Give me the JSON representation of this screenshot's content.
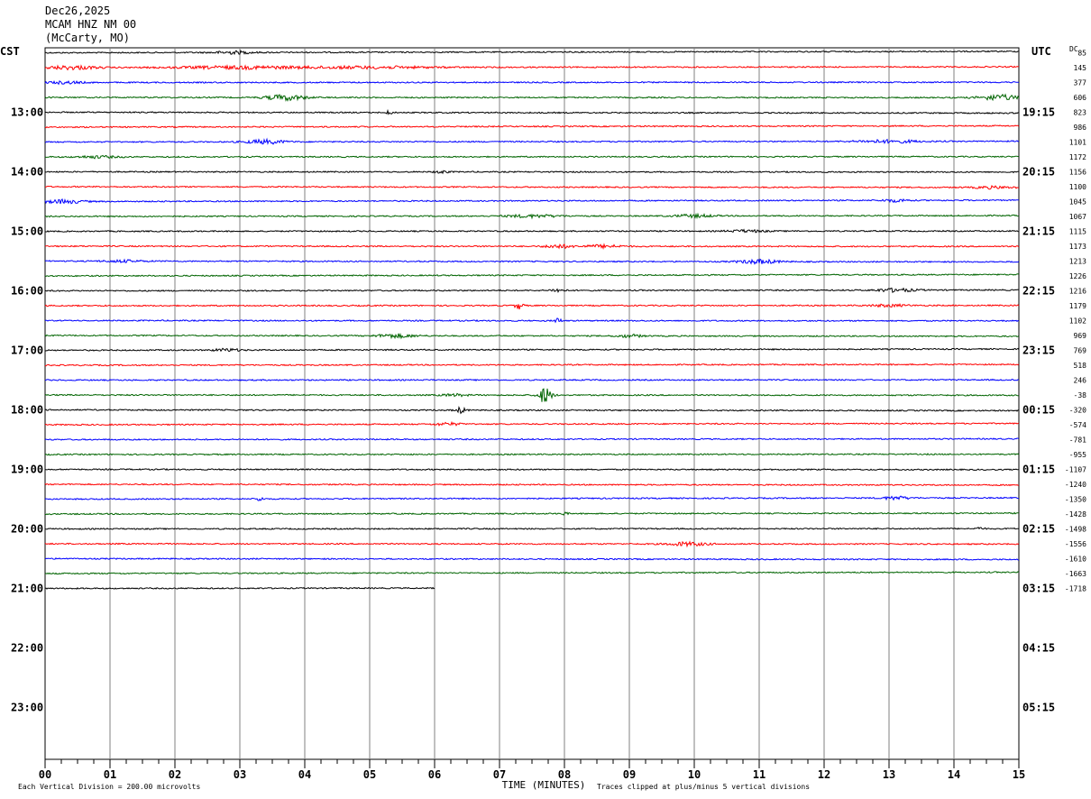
{
  "header": {
    "date": "Dec26,2025",
    "station": "MCAM HNZ NM 00",
    "location": "(McCarty, MO)"
  },
  "left_timezone": "CST",
  "right_timezone": "UTC",
  "dc_label": "DC",
  "footer": {
    "scale_note": "Each Vertical Division =  200.00 microvolts",
    "clip_note": "Traces clipped at plus/minus 5 vertical divisions"
  },
  "chart_data": {
    "type": "line",
    "xlabel": "TIME (MINUTES)",
    "xlim": [
      0,
      15
    ],
    "x_ticks": [
      "00",
      "01",
      "02",
      "03",
      "04",
      "05",
      "06",
      "07",
      "08",
      "09",
      "10",
      "11",
      "12",
      "13",
      "14",
      "15"
    ],
    "left_hour_labels": [
      "13:00",
      "14:00",
      "15:00",
      "16:00",
      "17:00",
      "18:00",
      "19:00",
      "20:00",
      "21:00",
      "22:00",
      "23:00"
    ],
    "right_hour_labels": [
      "19:15",
      "20:15",
      "21:15",
      "22:15",
      "23:15",
      "00:15",
      "01:15",
      "02:15",
      "03:15",
      "04:15",
      "05:15"
    ],
    "trace_colors": [
      "#000000",
      "#ff0000",
      "#0000ff",
      "#006400"
    ],
    "last_trace_end_minute": 6,
    "traces": [
      {
        "dc": "85",
        "events": [
          [
            2.9,
            0.3,
            1.5
          ]
        ]
      },
      {
        "dc": "145",
        "events": [
          [
            0.4,
            0.4,
            2
          ],
          [
            3.0,
            1.0,
            1.5
          ],
          [
            5.0,
            1.0,
            1.2
          ]
        ]
      },
      {
        "dc": "377",
        "events": [
          [
            0.3,
            0.3,
            1.2
          ]
        ]
      },
      {
        "dc": "606",
        "events": [
          [
            3.7,
            0.3,
            3
          ],
          [
            14.7,
            0.3,
            3
          ]
        ]
      },
      {
        "dc": "823",
        "events": [
          [
            5.3,
            0.05,
            2
          ]
        ]
      },
      {
        "dc": "986",
        "events": []
      },
      {
        "dc": "1101",
        "events": [
          [
            3.4,
            0.3,
            2.2
          ],
          [
            13.0,
            0.5,
            1.5
          ]
        ]
      },
      {
        "dc": "1172",
        "events": [
          [
            0.8,
            0.3,
            1.2
          ]
        ]
      },
      {
        "dc": "1156",
        "events": [
          [
            6.1,
            0.1,
            1.5
          ]
        ]
      },
      {
        "dc": "1100",
        "events": [
          [
            14.6,
            0.3,
            1.2
          ]
        ]
      },
      {
        "dc": "1045",
        "events": [
          [
            0.3,
            0.3,
            2
          ],
          [
            13.1,
            0.2,
            1.5
          ]
        ]
      },
      {
        "dc": "1067",
        "events": [
          [
            7.5,
            0.4,
            1.5
          ],
          [
            10.0,
            0.3,
            1.5
          ]
        ]
      },
      {
        "dc": "1115",
        "events": [
          [
            10.8,
            0.3,
            1.2
          ]
        ]
      },
      {
        "dc": "1173",
        "events": [
          [
            7.9,
            0.2,
            2
          ],
          [
            8.6,
            0.3,
            1.5
          ]
        ]
      },
      {
        "dc": "1213",
        "events": [
          [
            1.2,
            0.3,
            1.2
          ],
          [
            11.0,
            0.3,
            2.2
          ]
        ]
      },
      {
        "dc": "1226",
        "events": []
      },
      {
        "dc": "1216",
        "events": [
          [
            7.9,
            0.1,
            2
          ],
          [
            13.1,
            0.3,
            1.8
          ]
        ]
      },
      {
        "dc": "1179",
        "events": [
          [
            7.3,
            0.06,
            4
          ],
          [
            13.0,
            0.3,
            1.2
          ]
        ]
      },
      {
        "dc": "1102",
        "events": [
          [
            7.9,
            0.06,
            2.5
          ]
        ]
      },
      {
        "dc": "969",
        "events": [
          [
            5.4,
            0.3,
            2
          ],
          [
            9.0,
            0.2,
            1.5
          ]
        ]
      },
      {
        "dc": "769",
        "events": [
          [
            2.8,
            0.2,
            1.5
          ]
        ]
      },
      {
        "dc": "518",
        "events": []
      },
      {
        "dc": "246",
        "events": []
      },
      {
        "dc": "-38",
        "events": [
          [
            7.7,
            0.1,
            9
          ],
          [
            6.3,
            0.2,
            1.2
          ]
        ]
      },
      {
        "dc": "-320",
        "events": [
          [
            6.4,
            0.08,
            3
          ]
        ]
      },
      {
        "dc": "-574",
        "events": [
          [
            6.2,
            0.2,
            1.5
          ]
        ]
      },
      {
        "dc": "-781",
        "events": []
      },
      {
        "dc": "-955",
        "events": []
      },
      {
        "dc": "-1107",
        "events": []
      },
      {
        "dc": "-1240",
        "events": []
      },
      {
        "dc": "-1350",
        "events": [
          [
            3.3,
            0.05,
            2.5
          ],
          [
            13.1,
            0.2,
            1.8
          ]
        ]
      },
      {
        "dc": "-1428",
        "events": [
          [
            8.0,
            0.05,
            1.5
          ]
        ]
      },
      {
        "dc": "-1498",
        "events": [
          [
            14.4,
            0.05,
            1.8
          ]
        ]
      },
      {
        "dc": "-1556",
        "events": [
          [
            9.9,
            0.3,
            2
          ]
        ]
      },
      {
        "dc": "-1610",
        "events": []
      },
      {
        "dc": "-1663",
        "events": []
      },
      {
        "dc": "-1718",
        "events": []
      }
    ]
  }
}
